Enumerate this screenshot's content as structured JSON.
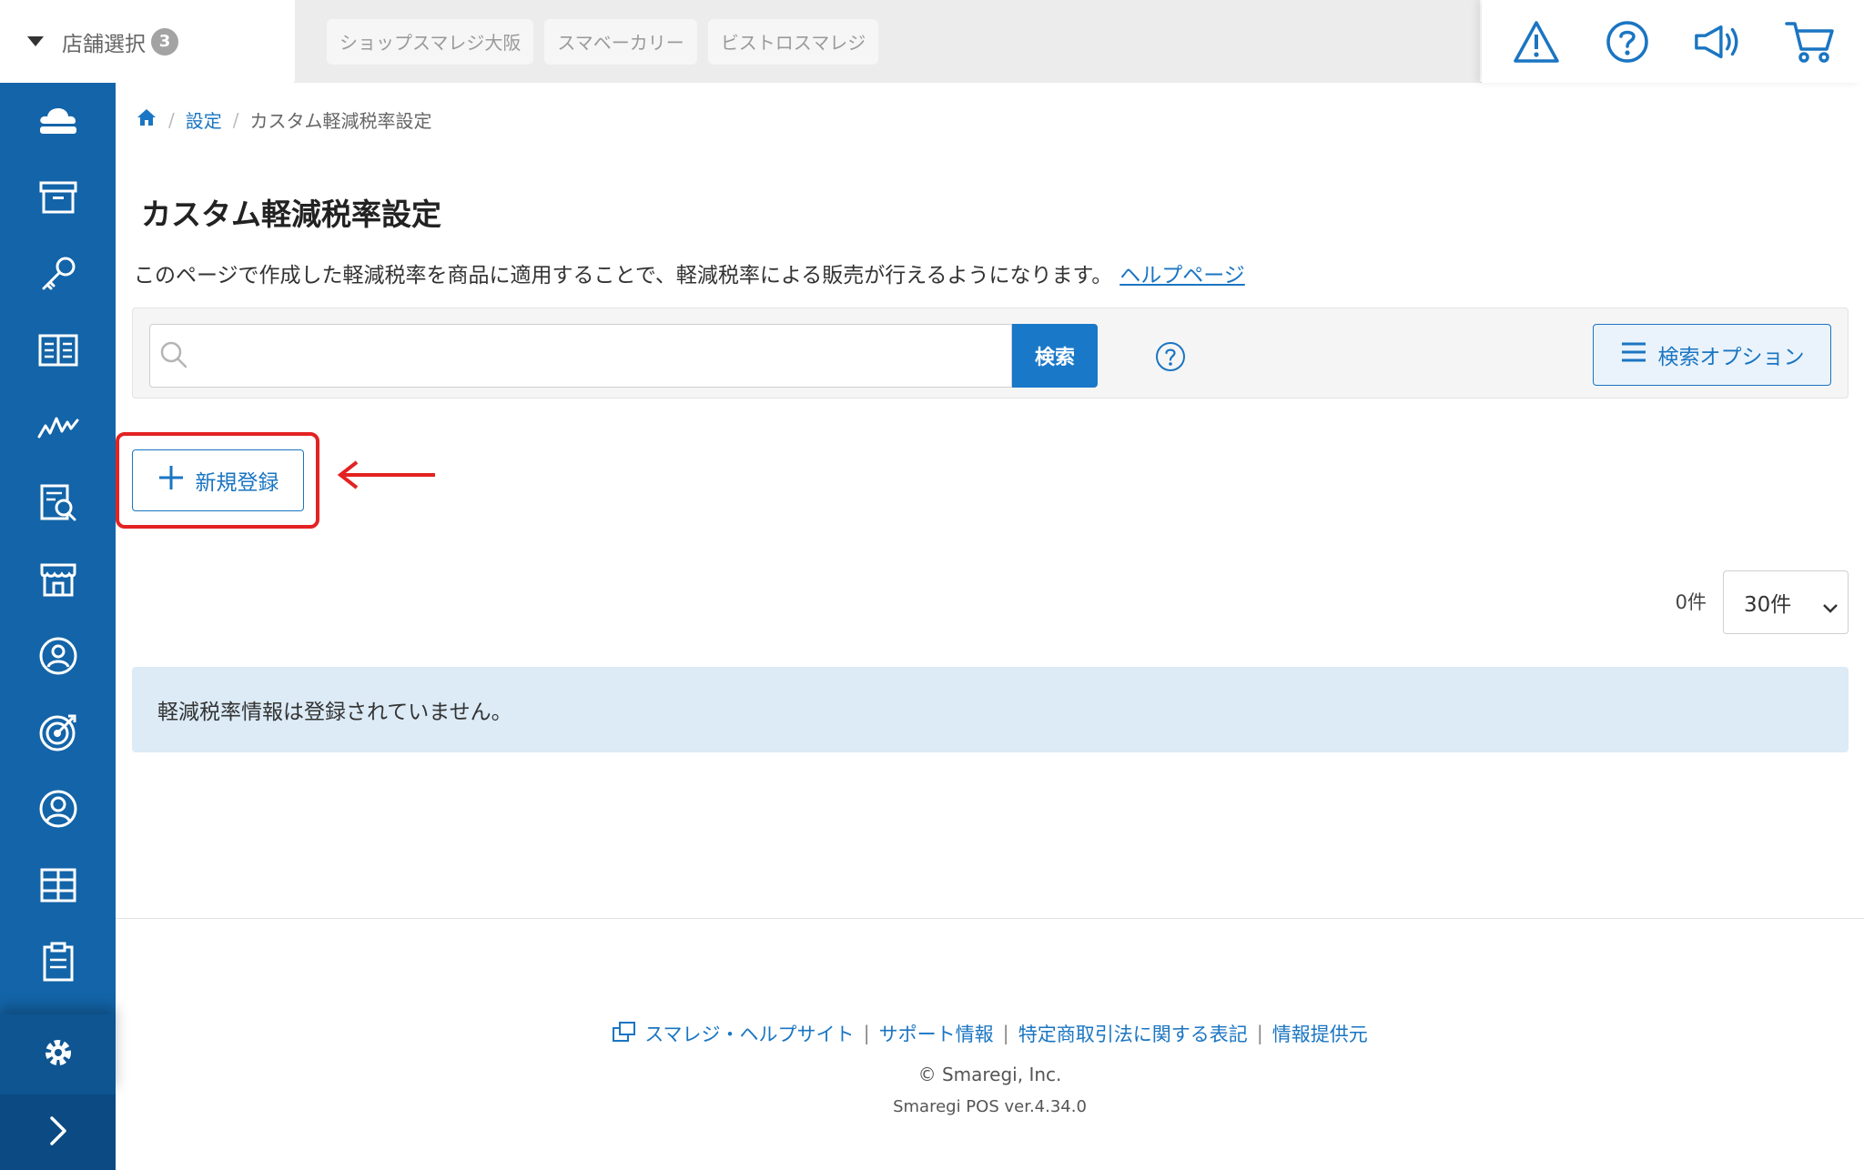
{
  "top_bar": {
    "store_select_label": "店舗選択",
    "store_count": "3",
    "store_tabs": [
      "ショップスマレジ大阪",
      "スマベーカリー",
      "ビストロスマレジ"
    ],
    "icons": [
      "warning-icon",
      "help-icon",
      "megaphone-icon",
      "cart-icon"
    ]
  },
  "sidebar": {
    "items": [
      "cloud-icon",
      "archive-box-icon",
      "key-icon",
      "book-icon",
      "chart-line-icon",
      "report-search-icon",
      "store-icon",
      "customer-icon",
      "target-icon",
      "user-circle-icon",
      "grid-icon",
      "clipboard-icon"
    ],
    "settings_icon": "gear-icon",
    "expand_icon": "chevron-right-icon"
  },
  "breadcrumb": {
    "home_icon": "home-icon",
    "settings": "設定",
    "current": "カスタム軽減税率設定"
  },
  "page": {
    "title": "カスタム軽減税率設定",
    "description": "このページで作成した軽減税率を商品に適用することで、軽減税率による販売が行えるようになります。",
    "help_link": "ヘルプページ"
  },
  "search": {
    "placeholder": "",
    "button": "検索",
    "options_button": "検索オプション"
  },
  "actions": {
    "new_button": "新規登録"
  },
  "list": {
    "count": "0件",
    "per_page": "30件",
    "empty_message": "軽減税率情報は登録されていません。"
  },
  "footer": {
    "links": [
      "スマレジ・ヘルプサイト",
      "サポート情報",
      "特定商取引法に関する表記",
      "情報提供元"
    ],
    "copyright": "© Smaregi, Inc.",
    "version": "Smaregi POS ver.4.34.0"
  },
  "colors": {
    "sidebar": "#1364a8",
    "accent": "#1a75c2",
    "highlight": "#e32222",
    "empty_bg": "#dcebf6"
  }
}
